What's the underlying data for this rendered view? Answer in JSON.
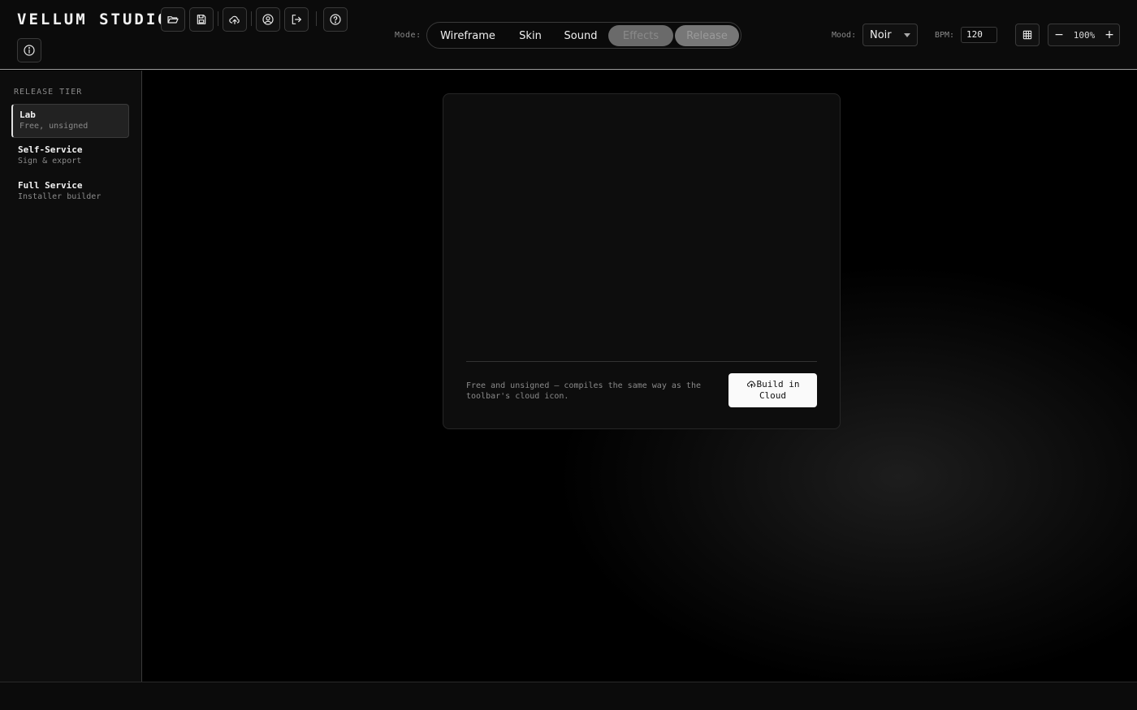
{
  "app": {
    "title": "VELLUM STUDIO"
  },
  "toolbar": {
    "icons": [
      "folder-open-icon",
      "save-icon",
      "cloud-upload-icon",
      "user-icon",
      "logout-icon",
      "help-icon",
      "info-icon"
    ]
  },
  "mode": {
    "label": "Mode:",
    "options": [
      "Wireframe",
      "Skin",
      "Sound",
      "Effects",
      "Release"
    ],
    "disabled": [
      "Effects",
      "Release"
    ]
  },
  "mood": {
    "label": "Mood:",
    "value": "Noir"
  },
  "bpm": {
    "label": "BPM:",
    "value": "120"
  },
  "zoom": {
    "minus": "−",
    "value": "100%",
    "plus": "+"
  },
  "sidebar": {
    "heading": "RELEASE TIER",
    "tiers": [
      {
        "name": "Lab",
        "sub": "Free, unsigned",
        "active": true
      },
      {
        "name": "Self-Service",
        "sub": "Sign & export",
        "active": false
      },
      {
        "name": "Full Service",
        "sub": "Installer builder",
        "active": false
      }
    ]
  },
  "panel": {
    "note": "Free and unsigned — compiles the same way as the toolbar's cloud icon.",
    "build_label_line1": "Build in",
    "build_label_line2": "Cloud"
  },
  "colors": {
    "background": "#000000",
    "accent": "#fafafa",
    "border": "#3a3a3a"
  }
}
